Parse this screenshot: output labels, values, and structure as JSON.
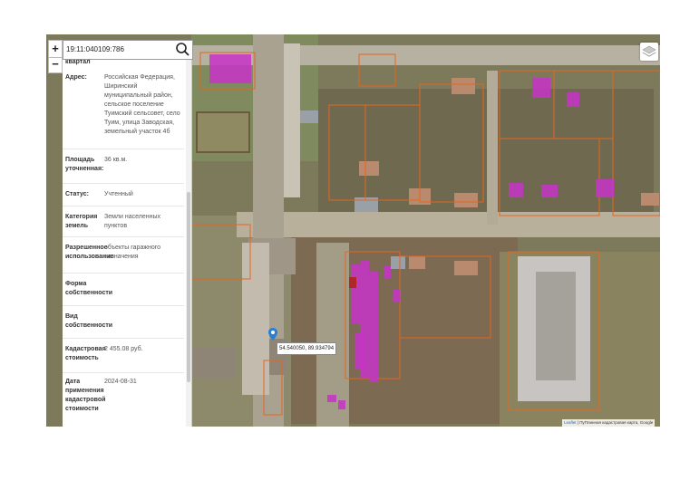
{
  "search": {
    "value": "19:11:040109:786",
    "placeholder": ""
  },
  "zoom": {
    "in_label": "+",
    "out_label": "−"
  },
  "info_panel": {
    "clipped_header": "квартал",
    "rows": [
      {
        "label": "Адрес:",
        "value": "Российская Федерация, Ширинский муниципальный район, сельское поселение Туимский сельсовет, село Туим, улица Заводская, земельный участок 4б"
      },
      {
        "label": "Площадь уточненная:",
        "value": "36 кв.м."
      },
      {
        "label": "Статус:",
        "value": "Учтенный"
      },
      {
        "label": "Категория земель",
        "value": "Земли населенных пунктов"
      },
      {
        "label": "Разрешенное использование",
        "value": "объекты гаражного назначения"
      },
      {
        "label": "Форма собственности",
        "value": ""
      },
      {
        "label": "Вид собственности",
        "value": ""
      },
      {
        "label": "Кадастровая стоимость",
        "value": "2 455.08 руб."
      },
      {
        "label": "Дата применения кадастровой стоимости",
        "value": "2024-08-31"
      }
    ]
  },
  "map": {
    "coordinates_label": "54.540050, 89.934794",
    "attribution_link": "Leaflet",
    "attribution_text": "| ПуПлинная кадастровая карта, Google"
  },
  "icons": {
    "search": "search-icon",
    "layers": "layers-icon",
    "marker": "map-marker-icon"
  },
  "colors": {
    "parcel_highlight": "#c832c8",
    "parcel_outline": "#e8641e",
    "marker": "#2a7fd4"
  }
}
